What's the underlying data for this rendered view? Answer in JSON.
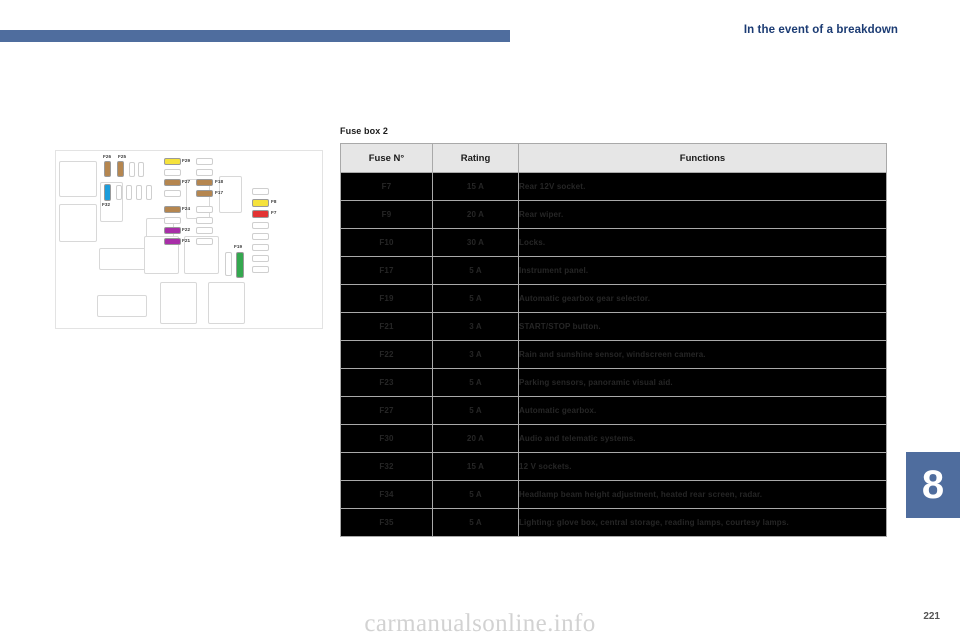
{
  "header": {
    "title": "In the event of a breakdown",
    "chapter": "8",
    "page_number": "221",
    "watermark": "carmanualsonline.info"
  },
  "section": {
    "title": "Fuse box 2"
  },
  "table": {
    "columns": [
      "Fuse N°",
      "Rating",
      "Functions"
    ],
    "rows": [
      {
        "fuse": "F7",
        "rating": "15 A",
        "functions": "Rear 12V socket."
      },
      {
        "fuse": "F9",
        "rating": "20 A",
        "functions": "Rear wiper."
      },
      {
        "fuse": "F10",
        "rating": "30 A",
        "functions": "Locks."
      },
      {
        "fuse": "F17",
        "rating": "5 A",
        "functions": "Instrument panel."
      },
      {
        "fuse": "F19",
        "rating": "5 A",
        "functions": "Automatic gearbox gear selector."
      },
      {
        "fuse": "F21",
        "rating": "3 A",
        "functions": "START/STOP button."
      },
      {
        "fuse": "F22",
        "rating": "3 A",
        "functions": "Rain and sunshine sensor, windscreen camera."
      },
      {
        "fuse": "F23",
        "rating": "5 A",
        "functions": "Parking sensors, panoramic visual aid."
      },
      {
        "fuse": "F27",
        "rating": "5 A",
        "functions": "Automatic gearbox."
      },
      {
        "fuse": "F30",
        "rating": "20 A",
        "functions": "Audio and telematic systems."
      },
      {
        "fuse": "F32",
        "rating": "15 A",
        "functions": "12 V sockets."
      },
      {
        "fuse": "F34",
        "rating": "5 A",
        "functions": "Headlamp beam height adjustment, heated rear screen, radar.",
        "tall": true
      },
      {
        "fuse": "F35",
        "rating": "5 A",
        "functions": "Lighting: glove box, central storage, reading lamps, courtesy lamps.",
        "tall": true
      }
    ]
  },
  "fusebox_diagram": {
    "labels": {
      "f26": "F26",
      "f25": "F25",
      "f32": "F32",
      "f29": "F29",
      "f27": "F27",
      "f18": "F18",
      "f17": "F17",
      "f24": "F24",
      "f22": "F22",
      "f21": "F21",
      "f8": "F8",
      "f7": "F7",
      "f19": "F19"
    },
    "colors": {
      "brown": "#b5864f",
      "blue": "#1c9ddb",
      "yellow": "#f5e23c",
      "purple": "#a82ea8",
      "red": "#e23333",
      "green": "#34a84f",
      "empty": "#ffffff"
    }
  }
}
